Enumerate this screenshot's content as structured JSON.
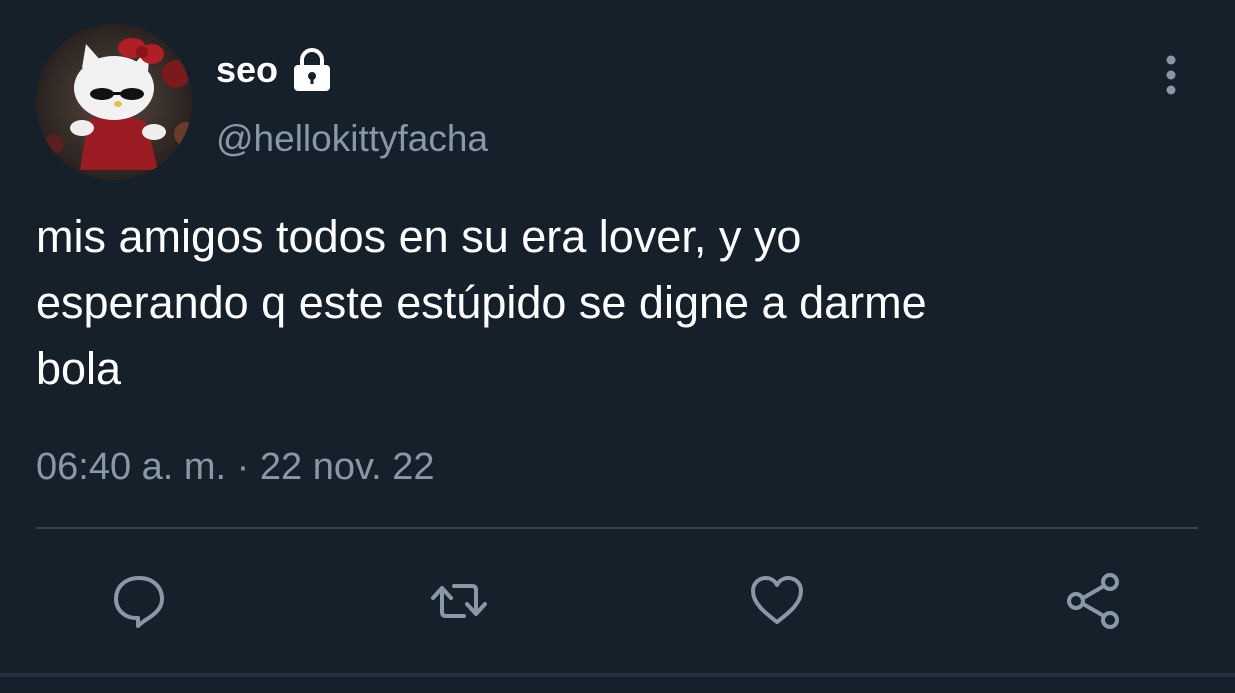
{
  "user": {
    "display_name": "seo",
    "handle": "@hellokittyfacha",
    "avatar_icon": "hello-kitty-avatar",
    "protected_icon": "lock-icon"
  },
  "tweet": {
    "text": "mis amigos todos en su era lover, y yo\nesperando q este estúpido se digne a darme\nbola",
    "timestamp": "06:40 a. m. · 22 nov. 22"
  },
  "actions": [
    {
      "name": "reply",
      "icon": "reply-icon"
    },
    {
      "name": "retweet",
      "icon": "retweet-icon"
    },
    {
      "name": "like",
      "icon": "heart-icon"
    },
    {
      "name": "share",
      "icon": "share-icon"
    }
  ],
  "colors": {
    "background": "#15202b",
    "primary_text": "#ffffff",
    "secondary_text": "#8899a6",
    "divider": "#38444d"
  }
}
